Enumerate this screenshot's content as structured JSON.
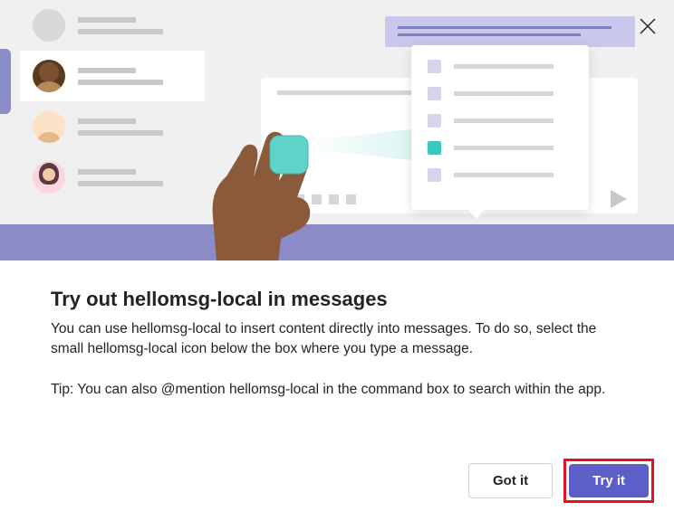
{
  "dialog": {
    "title": "Try out hellomsg-local in messages",
    "description": "You can use hellomsg-local to insert content directly into messages. To do so, select the small hellomsg-local icon below the box where you type a message.",
    "tip": "Tip: You can also @mention hellomsg-local in the command box to search within the app.",
    "buttons": {
      "secondary_label": "Got it",
      "primary_label": "Try it"
    }
  }
}
